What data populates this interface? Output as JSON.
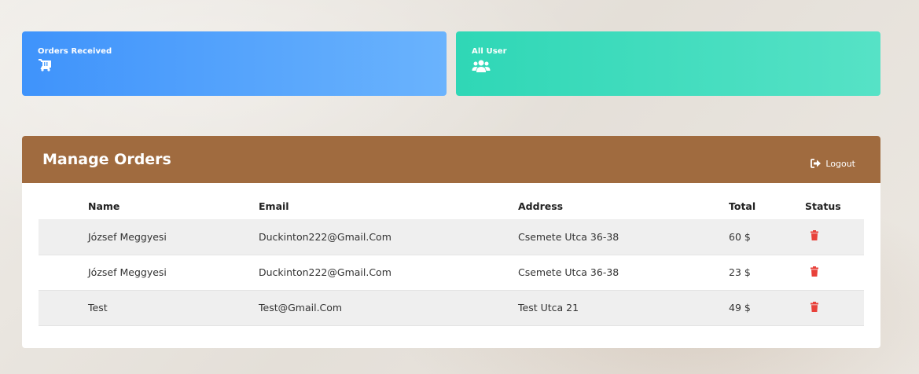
{
  "cards": {
    "orders_label": "Orders Received",
    "users_label": "All User"
  },
  "panel": {
    "title": "Manage Orders",
    "logout_label": "Logout"
  },
  "table": {
    "headers": [
      "Name",
      "Email",
      "Address",
      "Total",
      "Status"
    ],
    "rows": [
      {
        "name": "József Meggyesi",
        "email": "Duckinton222@Gmail.Com",
        "address": "Csemete Utca 36-38",
        "total": "60 $",
        "status_icon": "trash-icon"
      },
      {
        "name": "József Meggyesi",
        "email": "Duckinton222@Gmail.Com",
        "address": "Csemete Utca 36-38",
        "total": "23 $",
        "status_icon": "trash-icon"
      },
      {
        "name": "Test",
        "email": "Test@Gmail.Com",
        "address": "Test Utca 21",
        "total": "49 $",
        "status_icon": "trash-icon"
      }
    ]
  },
  "colors": {
    "orders_card": "#3f93fb",
    "users_card": "#2fd7b6",
    "panel_header": "#a06b3f",
    "trash": "#e8413a"
  }
}
